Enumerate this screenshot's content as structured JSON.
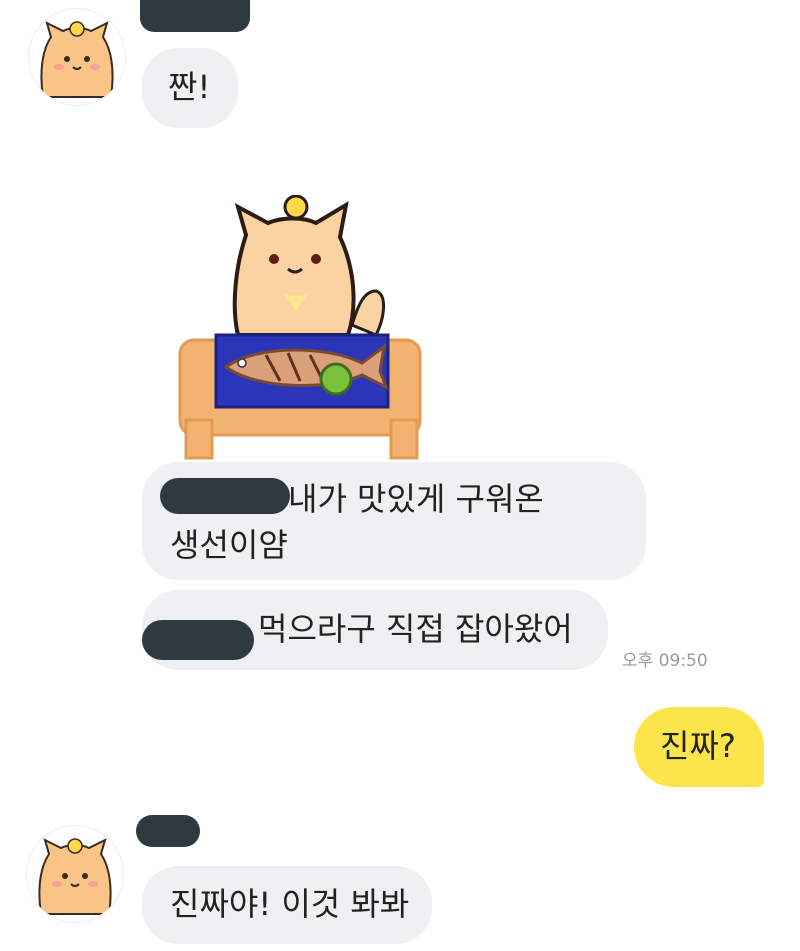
{
  "messages": [
    {
      "text": "짠!"
    },
    {
      "text_visible": "내가 맛있게 구워온",
      "line2": "생선이얌"
    },
    {
      "text": "먹으라구 직접 잡아왔어",
      "time": "오후 09:50"
    },
    {
      "text": "진짜?"
    },
    {
      "text": "진짜야! 이것 봐봐"
    }
  ],
  "colors": {
    "my_bubble": "#fce54a",
    "their_bubble": "#f0f0f2",
    "redaction": "#2e3a3f"
  },
  "icons": {
    "avatar": "orange-cat-avatar",
    "sticker": "cat-with-grilled-fish-sticker"
  }
}
